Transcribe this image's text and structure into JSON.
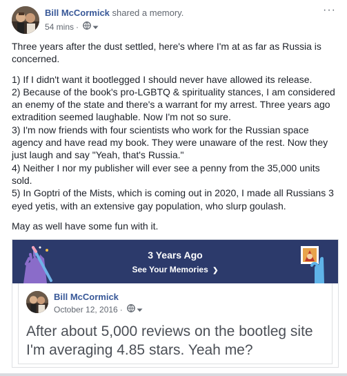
{
  "post": {
    "author": "Bill McCormick",
    "action": " shared a memory.",
    "time": "54 mins",
    "separator": "·",
    "more": "···",
    "paragraph1": "Three years after the dust settled, here's where I'm at as far as Russia is concerned.",
    "items": [
      "1) If I didn't want it bootlegged I should never have allowed its release.",
      "2) Because of the book's pro-LGBTQ & spirituality stances, I am considered an enemy of the state and there's a warrant for my arrest. Three years ago extradition seemed laughable. Now I'm not so sure.",
      "3) I'm now friends with four scientists who work for the Russian space agency and have read my book. They were unaware of the rest. Now they just laugh and say \"Yeah, that's Russia.\"",
      "4) Neither I nor my publisher will ever see a penny from the 35,000 units sold.",
      "5) In Goptri of the Mists, which is coming out in 2020, I made all Russians 3 eyed yetis, with an extensive gay population, who slurp goulash."
    ],
    "closing": "May as well have some fun with it."
  },
  "memory": {
    "title": "3 Years Ago",
    "link": "See Your Memories",
    "link_arrow": "❯",
    "banner_color": "#2c3a6b",
    "original": {
      "author": "Bill McCormick",
      "date": "October 12, 2016",
      "separator": "·",
      "text": "After about 5,000 reviews on the bootleg site I'm averaging 4.85 stars. Yeah me?"
    }
  },
  "colors": {
    "link": "#385898",
    "meta": "#616770",
    "text": "#1d2129"
  }
}
